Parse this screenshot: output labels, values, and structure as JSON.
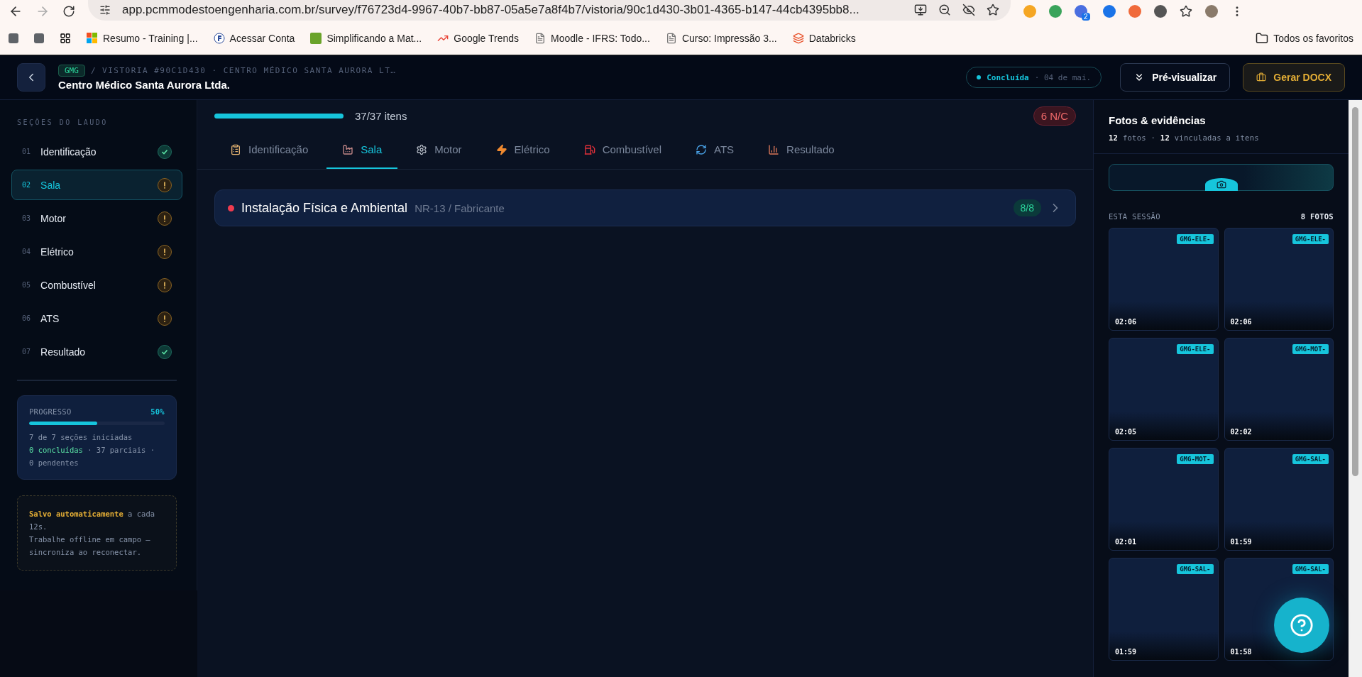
{
  "browser": {
    "url": "app.pcmmodestoengenharia.com.br/survey/f76723d4-9967-40b7-bb87-05a5e7a8f4b7/vistoria/90c1d430-3b01-4365-b147-44cb4395bb8...",
    "extension_badge": "2",
    "bookmarks": [
      {
        "label": "Resumo - Training |..."
      },
      {
        "label": "Acessar Conta"
      },
      {
        "label": "Simplificando a Mat..."
      },
      {
        "label": "Google Trends"
      },
      {
        "label": "Moodle - IFRS: Todo..."
      },
      {
        "label": "Curso: Impressão 3..."
      },
      {
        "label": "Databricks"
      }
    ],
    "all_bookmarks": "Todos os favoritos"
  },
  "header": {
    "tag": "GMG",
    "breadcrumb": "/ VISTORIA #90C1D430 · CENTRO MÉDICO SANTA AURORA LT…",
    "title": "Centro Médico Santa Aurora Ltda.",
    "status": "Concluída",
    "date": "· 04 de mai.",
    "preview_button": "Pré-visualizar",
    "docx_button": "Gerar DOCX"
  },
  "sidebar": {
    "heading": "SEÇÕES DO LAUDO",
    "items": [
      {
        "number": "01",
        "label": "Identificação",
        "kind": "done",
        "selected": false
      },
      {
        "number": "02",
        "label": "Sala",
        "kind": "warn",
        "selected": true
      },
      {
        "number": "03",
        "label": "Motor",
        "kind": "warn",
        "selected": false
      },
      {
        "number": "04",
        "label": "Elétrico",
        "kind": "warn",
        "selected": false
      },
      {
        "number": "05",
        "label": "Combustível",
        "kind": "warn",
        "selected": false
      },
      {
        "number": "06",
        "label": "ATS",
        "kind": "warn",
        "selected": false
      },
      {
        "number": "07",
        "label": "Resultado",
        "kind": "done",
        "selected": false
      }
    ],
    "progress": {
      "label": "PROGRESSO",
      "percent": "50%",
      "level": 0.5,
      "line1": "7 de 7 seções iniciadas",
      "done": "0 concluídas",
      "rest": "· 37 parciais ·",
      "pending": "0 pendentes"
    },
    "autosave": {
      "strong": "Salvo automaticamente",
      "text": "a cada 12s.",
      "line2": "Trabalhe offline em campo — sincroniza ao reconectar."
    }
  },
  "main": {
    "progress": {
      "level": 1,
      "label": "37/37 itens"
    },
    "nc_badge": "6 N/C",
    "tabs": [
      {
        "label": "Identificação",
        "selected": false
      },
      {
        "label": "Sala",
        "selected": true
      },
      {
        "label": "Motor",
        "selected": false
      },
      {
        "label": "Elétrico",
        "selected": false
      },
      {
        "label": "Combustível",
        "selected": false
      },
      {
        "label": "ATS",
        "selected": false
      },
      {
        "label": "Resultado",
        "selected": false
      }
    ],
    "groups": [
      {
        "title": "Instalação Física e Ambiental",
        "subtitle": "NR-13 / Fabricante",
        "count": "8/8",
        "color": "#ef3b4f"
      }
    ]
  },
  "photos": {
    "title": "Fotos & evidências",
    "count": "12",
    "count_label": "fotos ·",
    "linked": "12",
    "linked_label": "vinculadas a itens",
    "session_label": "ESTA SESSÃO",
    "session_count": "8 FOTOS",
    "items": [
      {
        "tag": "GMG-ELE-",
        "time": "02:06"
      },
      {
        "tag": "GMG-ELE-",
        "time": "02:06"
      },
      {
        "tag": "GMG-ELE-",
        "time": "02:05"
      },
      {
        "tag": "GMG-MOT-",
        "time": "02:02"
      },
      {
        "tag": "GMG-MOT-",
        "time": "02:01"
      },
      {
        "tag": "GMG-SAL-",
        "time": "01:59"
      },
      {
        "tag": "GMG-SAL-",
        "time": "01:59"
      },
      {
        "tag": "GMG-SAL-",
        "time": "01:58"
      }
    ]
  }
}
